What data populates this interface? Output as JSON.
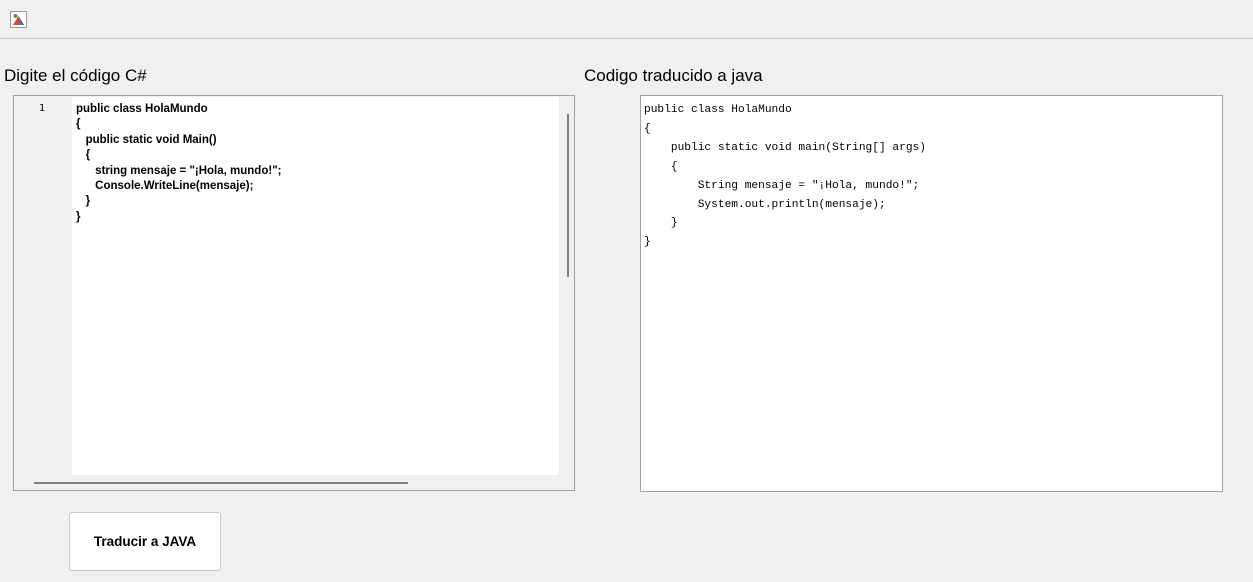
{
  "window": {
    "icon": "java-app-icon"
  },
  "csharp": {
    "label": "Digite el código C#",
    "line_number": "1",
    "code": "public class HolaMundo\n{\n   public static void Main()\n   {\n      string mensaje = \"¡Hola, mundo!\";\n      Console.WriteLine(mensaje);\n   }\n}"
  },
  "java": {
    "label": "Codigo traducido a java",
    "code": "public class HolaMundo\n{\n    public static void main(String[] args)\n    {\n        String mensaje = \"¡Hola, mundo!\";\n        System.out.println(mensaje);\n    }\n}"
  },
  "actions": {
    "translate_label": "Traducir a JAVA"
  }
}
